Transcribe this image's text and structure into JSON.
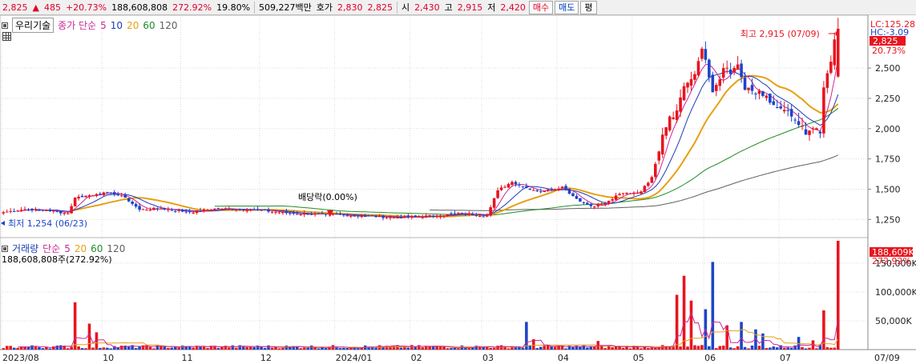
{
  "topbar": {
    "price": "2,825",
    "arrow": "▲",
    "change": "485",
    "change_pct": "+20.73%",
    "volume": "188,608,808",
    "volume_ratio": "272.92%",
    "turnover": "19.80%",
    "amount": "509,227백만",
    "ask_label": "호가",
    "ask1": "2,830",
    "ask2": "2,825",
    "open_label": "시",
    "open": "2,430",
    "high_label": "고",
    "high": "2,915",
    "low_label": "저",
    "low": "2,420",
    "buy_button": "매수",
    "sell_button": "매도",
    "eval_button": "평"
  },
  "price_legend": {
    "stock_name": "우리기술",
    "ma_label": "종가 단순",
    "periods": [
      "5",
      "10",
      "20",
      "60",
      "120"
    ]
  },
  "volume_legend": {
    "label": "거래량",
    "ma_label": "단순",
    "periods": [
      "5",
      "20",
      "60",
      "120"
    ],
    "current": "188,608,808주(272.92%)"
  },
  "annotations": {
    "high": "최고 2,915 (07/09)",
    "low": "최저 1,254 (06/23)",
    "dividend": "배당락(0.00%)",
    "lc": "LC:125.28",
    "hc": "HC:-3.09",
    "price_tag": "2,825",
    "pct_tag": "20.73%",
    "vol_tag": "188,609K",
    "vol_pct_tag": "272.92%"
  },
  "colors": {
    "up": "#e8141e",
    "down": "#1e44c8",
    "ma5": "#c82896",
    "ma10": "#1e3cb4",
    "ma20": "#e6a014",
    "ma60": "#1e8c28",
    "ma120": "#606060",
    "grid": "#dcdcdc"
  },
  "chart_data": [
    {
      "type": "candlestick",
      "title": "우리기술",
      "y_ticks": [
        "2,500",
        "2,250",
        "2,000",
        "1,750",
        "1,500",
        "1,250"
      ],
      "y_tick_values": [
        2500,
        2250,
        2000,
        1750,
        1500,
        1250
      ],
      "ylim": [
        1100,
        2930
      ],
      "x_ticks": [
        "2023/08",
        "10",
        "11",
        "12",
        "2024/01",
        "02",
        "03",
        "04",
        "05",
        "06",
        "07",
        "07/09"
      ],
      "x_tick_index": [
        0,
        28,
        50,
        72,
        93,
        114,
        134,
        155,
        176,
        196,
        217,
        232
      ],
      "n_bars": 234,
      "series_close_anchors": [
        {
          "i": 0,
          "v": 1310
        },
        {
          "i": 6,
          "v": 1335
        },
        {
          "i": 12,
          "v": 1325
        },
        {
          "i": 18,
          "v": 1300
        },
        {
          "i": 20,
          "v": 1430
        },
        {
          "i": 26,
          "v": 1460
        },
        {
          "i": 30,
          "v": 1470
        },
        {
          "i": 34,
          "v": 1430
        },
        {
          "i": 38,
          "v": 1330
        },
        {
          "i": 44,
          "v": 1340
        },
        {
          "i": 52,
          "v": 1310
        },
        {
          "i": 60,
          "v": 1340
        },
        {
          "i": 70,
          "v": 1330
        },
        {
          "i": 80,
          "v": 1300
        },
        {
          "i": 90,
          "v": 1290
        },
        {
          "i": 100,
          "v": 1280
        },
        {
          "i": 110,
          "v": 1265
        },
        {
          "i": 120,
          "v": 1280
        },
        {
          "i": 128,
          "v": 1300
        },
        {
          "i": 135,
          "v": 1280
        },
        {
          "i": 138,
          "v": 1490
        },
        {
          "i": 142,
          "v": 1560
        },
        {
          "i": 146,
          "v": 1510
        },
        {
          "i": 150,
          "v": 1480
        },
        {
          "i": 156,
          "v": 1520
        },
        {
          "i": 160,
          "v": 1420
        },
        {
          "i": 164,
          "v": 1360
        },
        {
          "i": 168,
          "v": 1380
        },
        {
          "i": 172,
          "v": 1460
        },
        {
          "i": 178,
          "v": 1480
        },
        {
          "i": 181,
          "v": 1600
        },
        {
          "i": 184,
          "v": 1950
        },
        {
          "i": 186,
          "v": 2100
        },
        {
          "i": 188,
          "v": 2150
        },
        {
          "i": 190,
          "v": 2350
        },
        {
          "i": 193,
          "v": 2450
        },
        {
          "i": 195,
          "v": 2660
        },
        {
          "i": 198,
          "v": 2300
        },
        {
          "i": 201,
          "v": 2500
        },
        {
          "i": 203,
          "v": 2450
        },
        {
          "i": 205,
          "v": 2530
        },
        {
          "i": 207,
          "v": 2320
        },
        {
          "i": 212,
          "v": 2270
        },
        {
          "i": 216,
          "v": 2170
        },
        {
          "i": 220,
          "v": 2100
        },
        {
          "i": 222,
          "v": 2030
        },
        {
          "i": 224,
          "v": 1950
        },
        {
          "i": 226,
          "v": 2000
        },
        {
          "i": 228,
          "v": 1960
        },
        {
          "i": 229,
          "v": 2340
        },
        {
          "i": 233,
          "v": 2825
        }
      ]
    },
    {
      "type": "bar",
      "title": "거래량",
      "y_ticks": [
        "150,000K",
        "100,000K",
        "50,000K"
      ],
      "y_tick_values": [
        150000,
        100000,
        50000
      ],
      "ylim": [
        0,
        190000
      ],
      "spikes": [
        {
          "i": 20,
          "v": 82000
        },
        {
          "i": 24,
          "v": 45000
        },
        {
          "i": 26,
          "v": 30000
        },
        {
          "i": 146,
          "v": 48000
        },
        {
          "i": 148,
          "v": 18000
        },
        {
          "i": 166,
          "v": 15000
        },
        {
          "i": 188,
          "v": 95000
        },
        {
          "i": 190,
          "v": 128000
        },
        {
          "i": 192,
          "v": 85000
        },
        {
          "i": 196,
          "v": 70000
        },
        {
          "i": 198,
          "v": 152000
        },
        {
          "i": 202,
          "v": 42000
        },
        {
          "i": 206,
          "v": 48000
        },
        {
          "i": 210,
          "v": 35000
        },
        {
          "i": 212,
          "v": 28000
        },
        {
          "i": 222,
          "v": 22000
        },
        {
          "i": 226,
          "v": 16000
        },
        {
          "i": 229,
          "v": 68000
        },
        {
          "i": 233,
          "v": 188609
        }
      ]
    }
  ]
}
